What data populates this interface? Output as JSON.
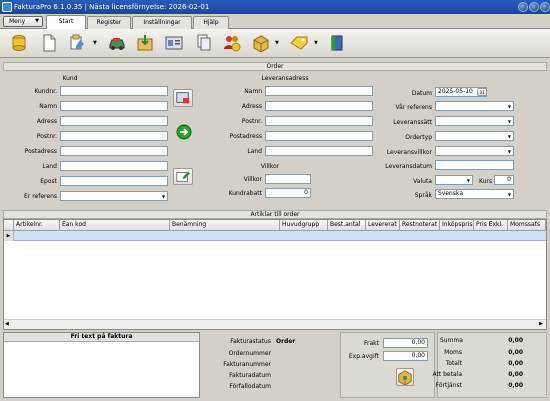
{
  "window": {
    "title": "FakturaPro 6.1.0.35 | Nästa licensförnyelse: 2026-02-01"
  },
  "menu": {
    "label": "Meny"
  },
  "tabs": [
    {
      "label": "Start",
      "active": true
    },
    {
      "label": "Register",
      "active": false
    },
    {
      "label": "Inställningar",
      "active": false
    },
    {
      "label": "Hjälp",
      "active": false
    }
  ],
  "toolbar": {
    "icons": [
      "database-icon",
      "new-document-icon",
      "edit-document-icon",
      "car-delivery-icon",
      "export-icon",
      "contact-card-icon",
      "copy-icon",
      "people-money-icon",
      "package-icon",
      "tag-icon",
      "book-icon"
    ]
  },
  "order": {
    "header": "Order",
    "kund": {
      "title": "Kund",
      "fields": {
        "kundnr": {
          "label": "Kundnr.",
          "value": ""
        },
        "namn": {
          "label": "Namn",
          "value": ""
        },
        "adress": {
          "label": "Adress",
          "value": ""
        },
        "postnr": {
          "label": "Postnr.",
          "value": ""
        },
        "postadress": {
          "label": "Postadress",
          "value": ""
        },
        "land": {
          "label": "Land",
          "value": ""
        },
        "epost": {
          "label": "Epost",
          "value": ""
        },
        "er_referens": {
          "label": "Er referens",
          "value": ""
        }
      }
    },
    "leverans": {
      "title": "Leveransadress",
      "fields": {
        "namn": {
          "label": "Namn",
          "value": ""
        },
        "adress": {
          "label": "Adress",
          "value": ""
        },
        "postnr": {
          "label": "Postnr.",
          "value": ""
        },
        "postadress": {
          "label": "Postadress",
          "value": ""
        },
        "land": {
          "label": "Land",
          "value": ""
        }
      }
    },
    "villkor": {
      "title": "Villkor",
      "villkor": {
        "label": "Villkor",
        "value": ""
      },
      "kundrabatt": {
        "label": "Kundrabatt",
        "value": "0"
      }
    },
    "right": {
      "datum": {
        "label": "Datum",
        "value": "2025-05-10",
        "cal": "31"
      },
      "var_referens": {
        "label": "Vår referens",
        "value": ""
      },
      "leveranssatt": {
        "label": "Leveranssätt",
        "value": ""
      },
      "ordertyp": {
        "label": "Ordertyp",
        "value": ""
      },
      "leveransvillkor": {
        "label": "Leveransvillkor",
        "value": ""
      },
      "leveransdatum": {
        "label": "Leveransdatum",
        "value": ""
      },
      "valuta": {
        "label": "Valuta",
        "value": ""
      },
      "kurs": {
        "label": "Kurs",
        "value": "0"
      },
      "sprak": {
        "label": "Språk",
        "value": "Svenska"
      }
    }
  },
  "articles": {
    "header": "Artiklar till order",
    "columns": [
      "Artikelnr.",
      "Ean kod",
      "Benämning",
      "Huvudgrupp",
      "Best.antal",
      "Levererat",
      "Restnoterat",
      "Inköpspris",
      "Pris Exkl.",
      "Momssats"
    ]
  },
  "bottom": {
    "fritext_title": "Fri text på faktura",
    "status": {
      "fakturastatus": {
        "label": "Fakturastatus",
        "value": "Order"
      },
      "ordernummer": {
        "label": "Ordernummer",
        "value": ""
      },
      "fakturanummer": {
        "label": "Fakturanummer",
        "value": ""
      },
      "fakturadatum": {
        "label": "Fakturadatum",
        "value": ""
      },
      "forfallodatum": {
        "label": "Förfallodatum",
        "value": ""
      }
    },
    "frakt": {
      "label": "Frakt",
      "value": "0,00"
    },
    "expavgift": {
      "label": "Exp.avgift",
      "value": "0,00"
    },
    "summary": {
      "summa": {
        "label": "Summa",
        "value": "0,00"
      },
      "moms": {
        "label": "Moms",
        "value": "0,00"
      },
      "totalt": {
        "label": "Totalt",
        "value": "0,00"
      },
      "att_betala": {
        "label": "Att betala",
        "value": "0,00"
      },
      "fortjanst": {
        "label": "Förtjänst",
        "value": "0,00"
      }
    }
  }
}
